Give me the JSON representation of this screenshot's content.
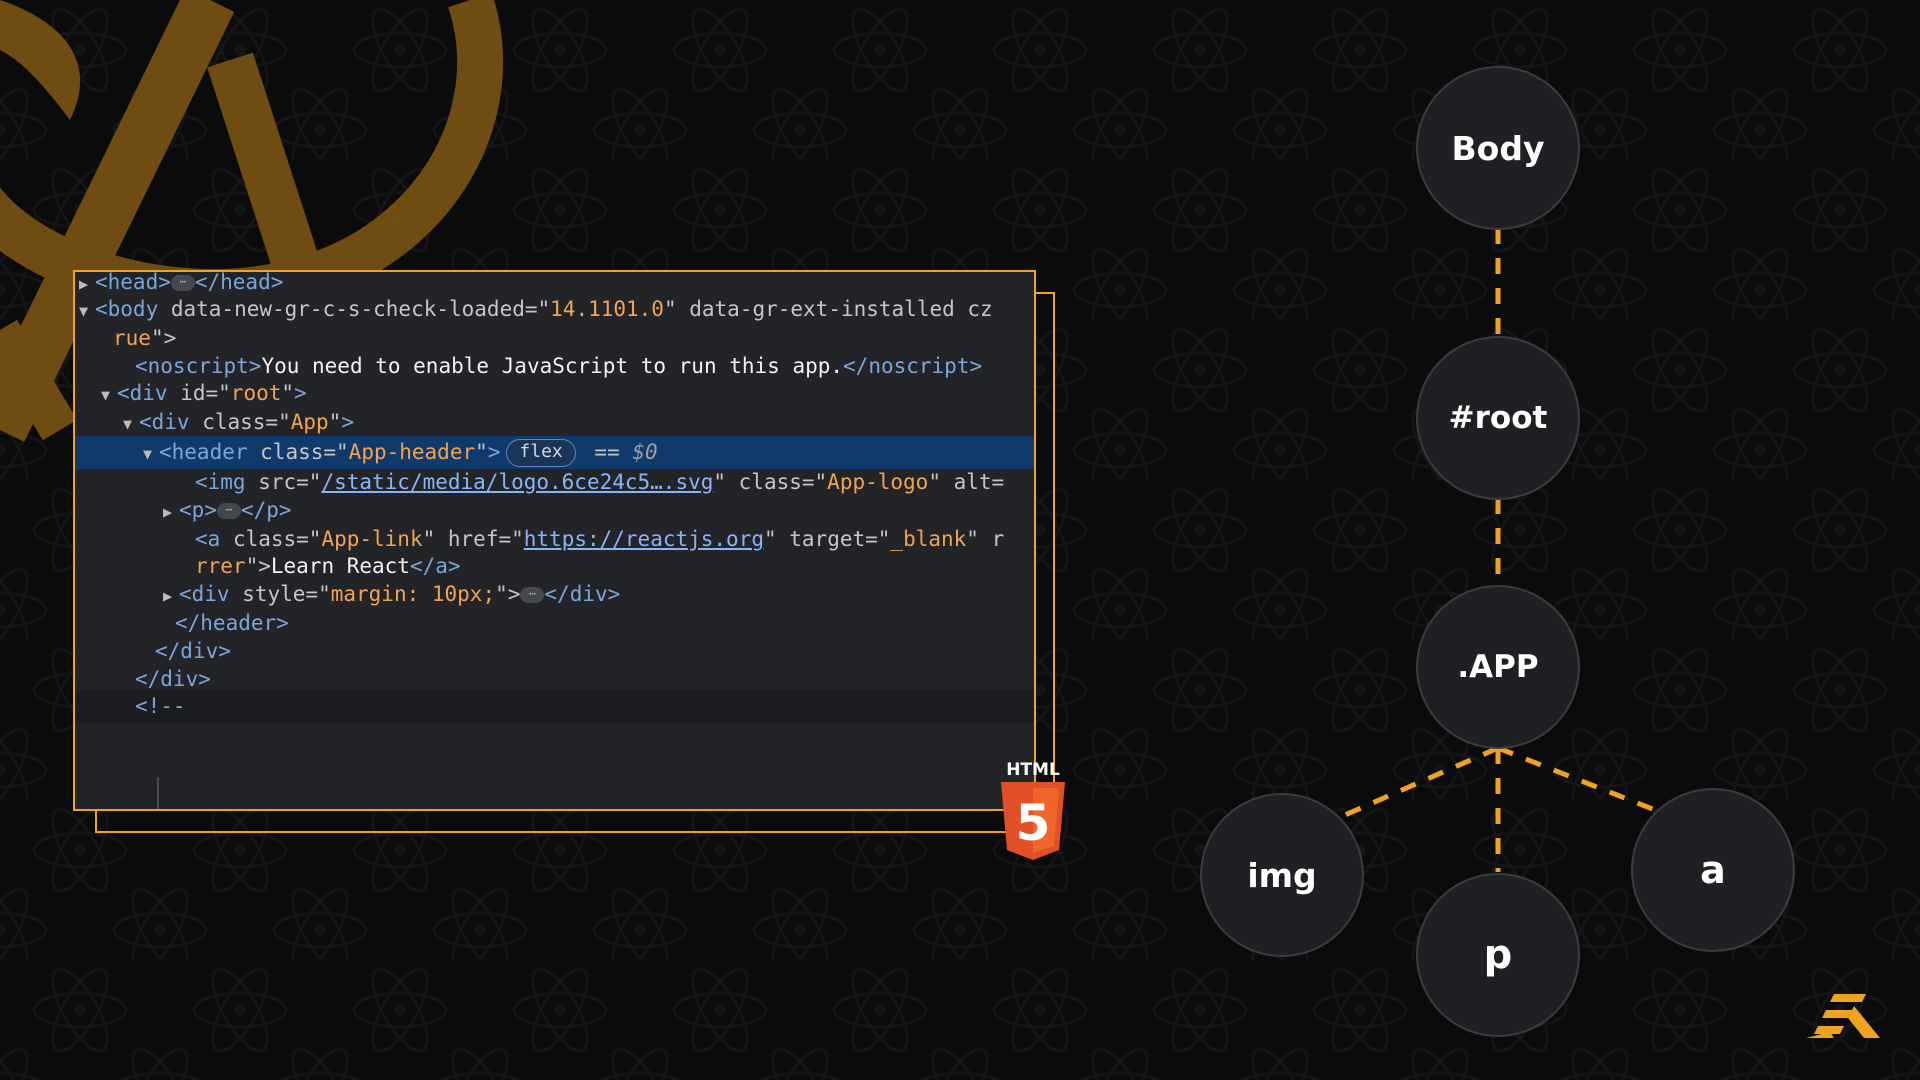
{
  "code_panel": {
    "lines": [
      {
        "tri": "▶",
        "parts": [
          [
            "tag",
            "<head>"
          ],
          [
            "ellip",
            ""
          ],
          [
            "tag",
            "</head>"
          ]
        ]
      },
      {
        "tri": "▼",
        "parts": [
          [
            "tag",
            "<body "
          ],
          [
            "attr",
            "data-new-gr-c-s-check-loaded=\""
          ],
          [
            "val",
            "14.1101.0"
          ],
          [
            "attr",
            "\" data-gr-ext-installed cz"
          ]
        ]
      },
      {
        "tri": "",
        "parts": [
          [
            "val",
            "rue"
          ],
          [
            "attr",
            "\">"
          ]
        ]
      },
      {
        "tri": "",
        "parts": [
          [
            "tag",
            "<noscript>"
          ],
          [
            "txt",
            "You need to enable JavaScript to run this app."
          ],
          [
            "tag",
            "</noscript>"
          ]
        ]
      },
      {
        "tri": "▼",
        "parts": [
          [
            "tag",
            "<div "
          ],
          [
            "attr",
            "id=\""
          ],
          [
            "val",
            "root"
          ],
          [
            "attr",
            "\""
          ],
          [
            "tag",
            ">"
          ]
        ]
      },
      {
        "tri": "▼",
        "parts": [
          [
            "tag",
            "<div "
          ],
          [
            "attr",
            "class=\""
          ],
          [
            "val",
            "App"
          ],
          [
            "attr",
            "\""
          ],
          [
            "tag",
            ">"
          ]
        ]
      },
      {
        "tri": "▼",
        "parts": [
          [
            "tag",
            "<header "
          ],
          [
            "attr",
            "class=\""
          ],
          [
            "val",
            "App-header"
          ],
          [
            "attr",
            "\""
          ],
          [
            "tag",
            ">"
          ],
          [
            "pill",
            "flex"
          ],
          [
            "attr",
            " == "
          ],
          [
            "dollar",
            "$0"
          ]
        ]
      },
      {
        "tri": "",
        "parts": [
          [
            "tag",
            "<img "
          ],
          [
            "attr",
            "src=\""
          ],
          [
            "link",
            "/static/media/logo.6ce24c5….svg"
          ],
          [
            "attr",
            "\" class=\""
          ],
          [
            "val",
            "App-logo"
          ],
          [
            "attr",
            "\" alt="
          ]
        ]
      },
      {
        "tri": "▶",
        "parts": [
          [
            "tag",
            "<p>"
          ],
          [
            "ellip",
            ""
          ],
          [
            "tag",
            "</p>"
          ]
        ]
      },
      {
        "tri": "",
        "parts": [
          [
            "tag",
            "<a "
          ],
          [
            "attr",
            "class=\""
          ],
          [
            "val",
            "App-link"
          ],
          [
            "attr",
            "\" href=\""
          ],
          [
            "link",
            "https://reactjs.org"
          ],
          [
            "attr",
            "\" target=\""
          ],
          [
            "val",
            "_blank"
          ],
          [
            "attr",
            "\" r"
          ]
        ]
      },
      {
        "tri": "",
        "parts": [
          [
            "val",
            "rrer"
          ],
          [
            "attr",
            "\">"
          ],
          [
            "txt",
            "Learn React"
          ],
          [
            "tag",
            "</a>"
          ]
        ]
      },
      {
        "tri": "▶",
        "parts": [
          [
            "tag",
            "<div "
          ],
          [
            "attr",
            "style=\""
          ],
          [
            "val",
            "margin: 10px;"
          ],
          [
            "attr",
            "\">"
          ],
          [
            "ellip",
            ""
          ],
          [
            "tag",
            "</div>"
          ]
        ]
      },
      {
        "tri": "",
        "parts": [
          [
            "tag",
            "</header>"
          ]
        ]
      },
      {
        "tri": "",
        "parts": [
          [
            "tag",
            "</div>"
          ]
        ]
      },
      {
        "tri": "",
        "parts": [
          [
            "tag",
            "</div>"
          ]
        ]
      },
      {
        "tri": "",
        "parts": [
          [
            "tag",
            "<!--"
          ]
        ]
      }
    ]
  },
  "html5_badge": {
    "label": "HTML",
    "number": "5"
  },
  "tree": {
    "nodes": {
      "body": "Body",
      "root": "#root",
      "app": ".APP",
      "img": "img",
      "p": "p",
      "a": "a"
    },
    "edge_color": "#f0a321"
  },
  "colors": {
    "accent": "#f0a321",
    "background": "#0b0b0c",
    "node_fill": "#1f2023",
    "highlight_row": "#103a6b"
  }
}
